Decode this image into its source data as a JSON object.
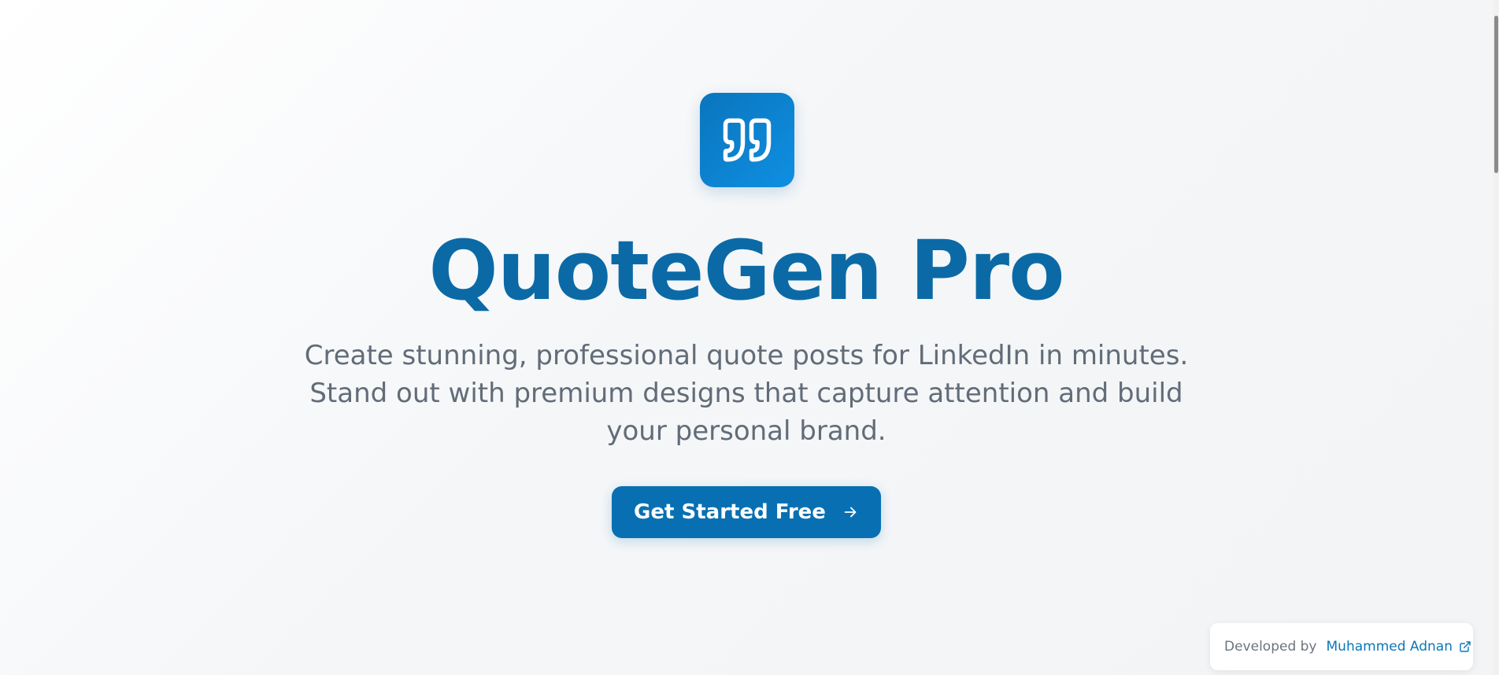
{
  "hero": {
    "logo_icon": "quote-icon",
    "title": "QuoteGen Pro",
    "subtitle": "Create stunning, professional quote posts for LinkedIn in minutes. Stand out with premium designs that capture attention and build your personal brand.",
    "cta_label": "Get Started Free",
    "cta_icon": "arrow-right-icon"
  },
  "footer": {
    "developed_by_label": "Developed by",
    "author_name": "Muhammed Adnan",
    "author_link_icon": "external-link-icon"
  },
  "colors": {
    "brand_primary": "#0b6aa6",
    "button_bg": "#0870b2",
    "logo_gradient_start": "#0a75bd",
    "logo_gradient_end": "#0f8fe2",
    "subtitle_text": "#626c78",
    "link_text": "#0b77b8"
  }
}
